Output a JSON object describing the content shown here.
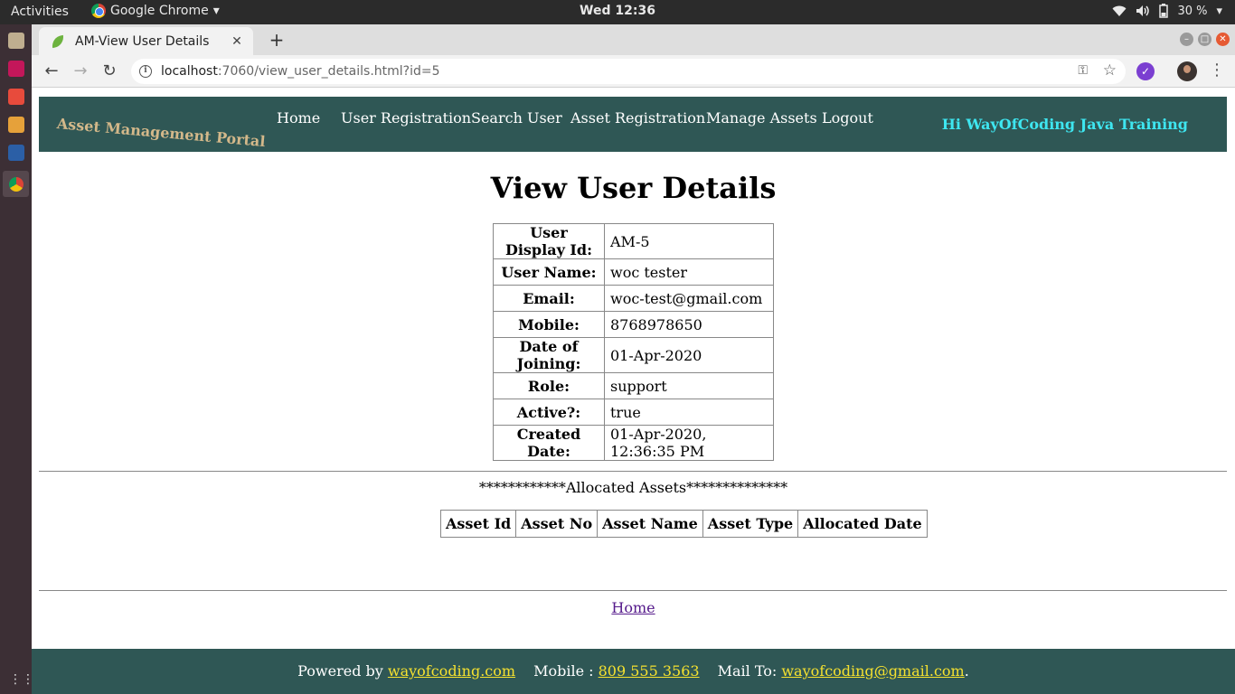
{
  "os": {
    "activities": "Activities",
    "app_name": "Google Chrome",
    "clock": "Wed 12:36",
    "battery": "30 %"
  },
  "browser": {
    "tab_title": "AM-View User Details",
    "url_host": "localhost",
    "url_path": ":7060/view_user_details.html?id=5"
  },
  "nav": {
    "brand": "Asset Management Portal",
    "links": [
      "Home",
      "User Registration",
      "Search User",
      "Asset Registration",
      "Manage Assets",
      "Logout"
    ],
    "greeting": "Hi WayOfCoding Java Training"
  },
  "page": {
    "title": "View User Details",
    "details": [
      {
        "label": "User Display Id:",
        "value": "AM-5"
      },
      {
        "label": "User Name:",
        "value": "woc tester"
      },
      {
        "label": "Email:",
        "value": "woc-test@gmail.com"
      },
      {
        "label": "Mobile:",
        "value": "8768978650"
      },
      {
        "label": "Date of Joining:",
        "value": "01-Apr-2020"
      },
      {
        "label": "Role:",
        "value": "support"
      },
      {
        "label": "Active?:",
        "value": "true"
      },
      {
        "label": "Created Date:",
        "value": "01-Apr-2020, 12:36:35 PM"
      }
    ],
    "allocated_title": "************Allocated Assets**************",
    "asset_columns": [
      "Asset Id",
      "Asset No",
      "Asset Name",
      "Asset Type",
      "Allocated Date"
    ],
    "home_link": "Home"
  },
  "footer": {
    "powered_label": "Powered by ",
    "powered_link": "wayofcoding.com",
    "mobile_label": "Mobile : ",
    "mobile_link": "809 555 3563",
    "mail_label": "Mail To: ",
    "mail_link": "wayofcoding@gmail.com",
    "mail_suffix": "."
  }
}
